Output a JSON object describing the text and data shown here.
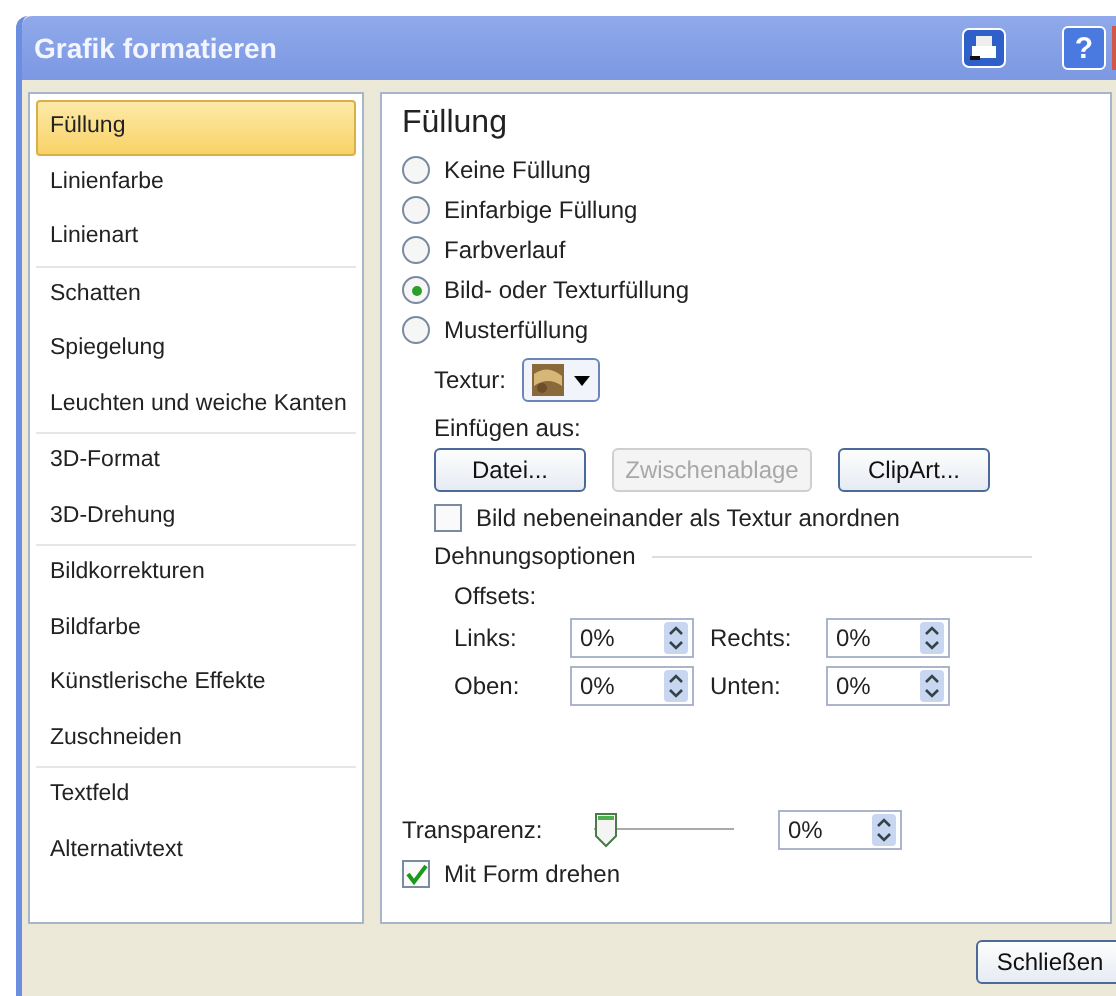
{
  "window": {
    "title": "Grafik formatieren",
    "help_button": "?"
  },
  "sidebar": {
    "groups": [
      {
        "items": [
          {
            "label": "Füllung",
            "selected": true
          },
          {
            "label": "Linienfarbe",
            "selected": false
          },
          {
            "label": "Linienart",
            "selected": false
          }
        ]
      },
      {
        "items": [
          {
            "label": "Schatten",
            "selected": false
          },
          {
            "label": "Spiegelung",
            "selected": false
          },
          {
            "label": "Leuchten und weiche Kanten",
            "selected": false
          }
        ]
      },
      {
        "items": [
          {
            "label": "3D-Format",
            "selected": false
          },
          {
            "label": "3D-Drehung",
            "selected": false
          }
        ]
      },
      {
        "items": [
          {
            "label": "Bildkorrekturen",
            "selected": false
          },
          {
            "label": "Bildfarbe",
            "selected": false
          },
          {
            "label": "Künstlerische Effekte",
            "selected": false
          },
          {
            "label": "Zuschneiden",
            "selected": false
          }
        ]
      },
      {
        "items": [
          {
            "label": "Textfeld",
            "selected": false
          },
          {
            "label": "Alternativtext",
            "selected": false
          }
        ]
      }
    ]
  },
  "panel": {
    "heading": "Füllung",
    "fill_options": [
      {
        "label": "Keine Füllung",
        "selected": false
      },
      {
        "label": "Einfarbige Füllung",
        "selected": false
      },
      {
        "label": "Farbverlauf",
        "selected": false
      },
      {
        "label": "Bild- oder Texturfüllung",
        "selected": true
      },
      {
        "label": "Musterfüllung",
        "selected": false
      }
    ],
    "texture_label": "Textur:",
    "insert_from_label": "Einfügen aus:",
    "insert_buttons": [
      {
        "label": "Datei...",
        "disabled": false
      },
      {
        "label": "Zwischenablage",
        "disabled": true
      },
      {
        "label": "ClipArt...",
        "disabled": false
      }
    ],
    "tile_checkbox": {
      "label": "Bild nebeneinander als Textur anordnen",
      "checked": false
    },
    "stretch_section": "Dehnungsoptionen",
    "offsets_label": "Offsets:",
    "offsets": [
      {
        "label": "Links:",
        "value": "0%"
      },
      {
        "label": "Rechts:",
        "value": "0%"
      },
      {
        "label": "Oben:",
        "value": "0%"
      },
      {
        "label": "Unten:",
        "value": "0%"
      }
    ],
    "transparency": {
      "label": "Transparenz:",
      "level": 0,
      "value": "0%"
    },
    "rotate_checkbox": {
      "label": "Mit Form drehen",
      "checked": true
    }
  },
  "buttons": [
    "Schließen"
  ]
}
